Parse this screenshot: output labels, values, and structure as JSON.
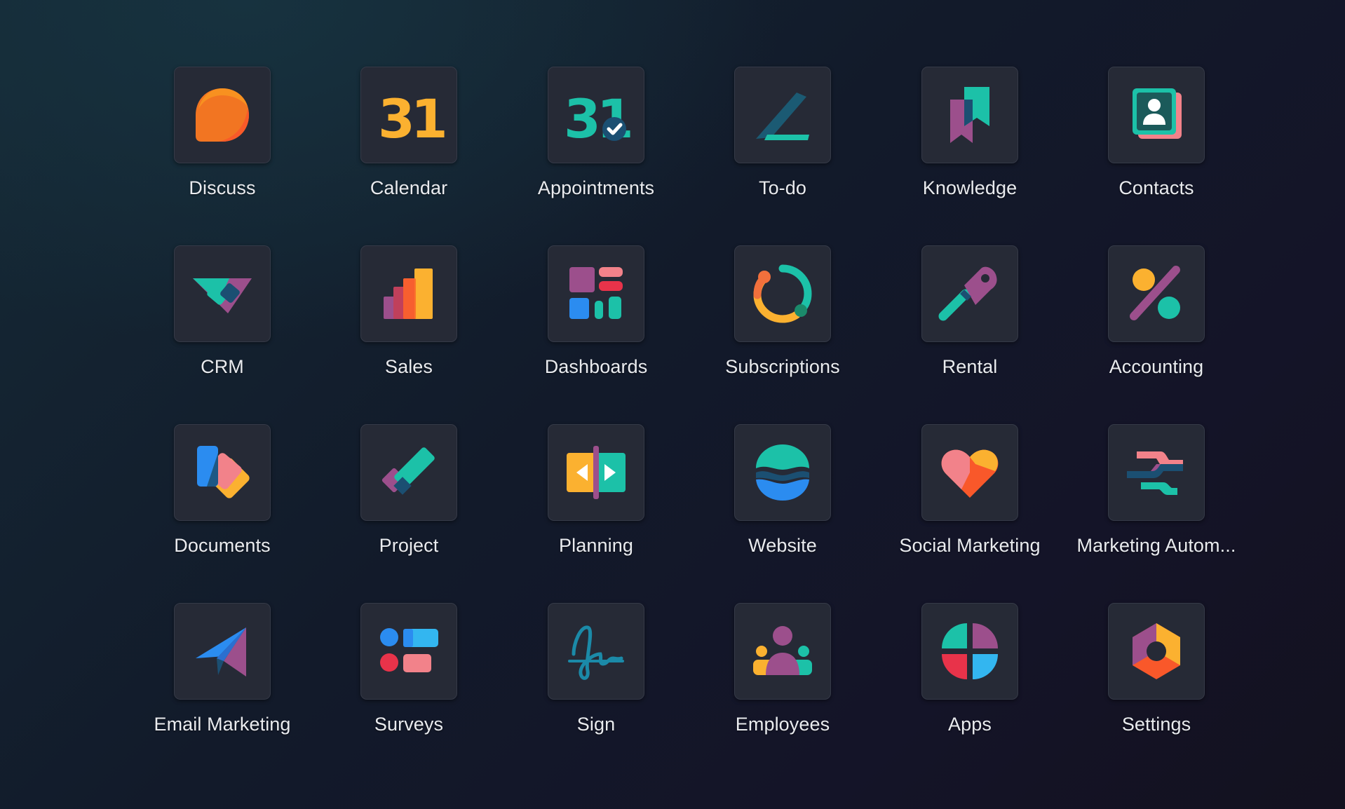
{
  "apps": [
    {
      "label": "Discuss",
      "icon": "discuss-icon"
    },
    {
      "label": "Calendar",
      "icon": "calendar-icon"
    },
    {
      "label": "Appointments",
      "icon": "appointments-icon"
    },
    {
      "label": "To-do",
      "icon": "todo-icon"
    },
    {
      "label": "Knowledge",
      "icon": "knowledge-icon"
    },
    {
      "label": "Contacts",
      "icon": "contacts-icon"
    },
    {
      "label": "CRM",
      "icon": "crm-icon"
    },
    {
      "label": "Sales",
      "icon": "sales-icon"
    },
    {
      "label": "Dashboards",
      "icon": "dashboards-icon"
    },
    {
      "label": "Subscriptions",
      "icon": "subscriptions-icon"
    },
    {
      "label": "Rental",
      "icon": "rental-icon"
    },
    {
      "label": "Accounting",
      "icon": "accounting-icon"
    },
    {
      "label": "Documents",
      "icon": "documents-icon"
    },
    {
      "label": "Project",
      "icon": "project-icon"
    },
    {
      "label": "Planning",
      "icon": "planning-icon"
    },
    {
      "label": "Website",
      "icon": "website-icon"
    },
    {
      "label": "Social Marketing",
      "icon": "social-marketing-icon"
    },
    {
      "label": "Marketing Autom...",
      "icon": "marketing-automation-icon"
    },
    {
      "label": "Email Marketing",
      "icon": "email-marketing-icon"
    },
    {
      "label": "Surveys",
      "icon": "surveys-icon"
    },
    {
      "label": "Sign",
      "icon": "sign-icon"
    },
    {
      "label": "Employees",
      "icon": "employees-icon"
    },
    {
      "label": "Apps",
      "icon": "apps-icon"
    },
    {
      "label": "Settings",
      "icon": "settings-icon"
    }
  ],
  "calendar_day": "31",
  "colors": {
    "background": "#131a28",
    "tile": "#262a36",
    "label": "#e9ebef"
  }
}
